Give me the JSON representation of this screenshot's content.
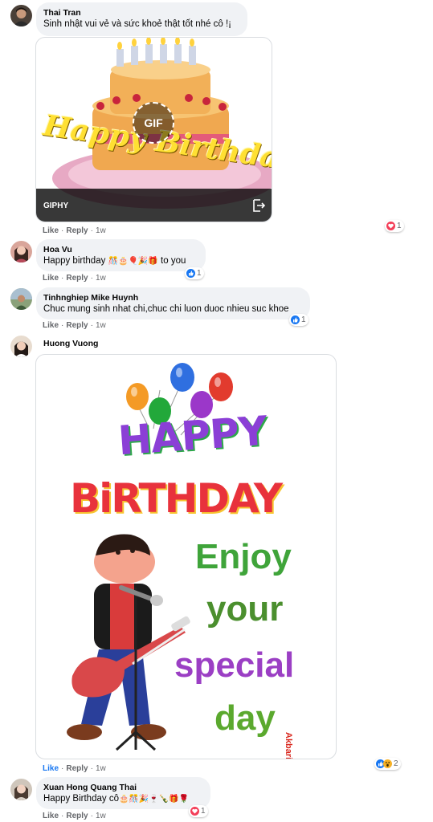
{
  "comments": [
    {
      "author": "Thai Tran",
      "text": "Sinh nhật vui vẻ và sức khoẻ thật tốt nhé cô !¡",
      "gif": {
        "badge": "GIF",
        "caption": "Happy Birthday!",
        "source": "GIPHY"
      },
      "actions": {
        "like": "Like",
        "reply": "Reply",
        "time": "1w"
      },
      "reaction_count": "1",
      "reaction_icons": [
        "heart-icon"
      ]
    },
    {
      "author": "Hoa Vu",
      "text": "Happy birthday",
      "emojis": "🎊🎂🎈🎉🎁",
      "text_suffix": "to you",
      "actions": {
        "like": "Like",
        "reply": "Reply",
        "time": "1w"
      },
      "reaction_count": "1",
      "reaction_icons": [
        "like-icon"
      ]
    },
    {
      "author": "Tinhnghiep Mike Huynh",
      "text": "Chuc mung sinh nhat chi,chuc chi luon duoc nhieu suc khoe",
      "actions": {
        "like": "Like",
        "reply": "Reply",
        "time": "1w"
      },
      "reaction_count": "1",
      "reaction_icons": [
        "like-icon"
      ]
    },
    {
      "author": "Huong Vuong",
      "image": {
        "happy": "HAPPY",
        "birthday": "BiRTHDAY",
        "line1": "Enjoy",
        "line2": "your",
        "line3": "special",
        "line4": "day",
        "signature": "Akbarian"
      },
      "actions": {
        "like": "Like",
        "reply": "Reply",
        "time": "1w"
      },
      "reaction_count": "2",
      "reaction_icons": [
        "like-icon",
        "wow-icon"
      ]
    },
    {
      "author": "Xuan Hong Quang Thai",
      "text": "Happy Birthday cô",
      "emojis": "🎂🎊🎉🍷🍾🎁🌹",
      "actions": {
        "like": "Like",
        "reply": "Reply",
        "time": "1w"
      },
      "reaction_count": "1",
      "reaction_icons": [
        "heart-icon"
      ]
    }
  ],
  "colors": {
    "bubble_bg": "#f0f2f5",
    "link_blue": "#1877f2",
    "meta_gray": "#65676b",
    "heart_red": "#f33e58"
  }
}
